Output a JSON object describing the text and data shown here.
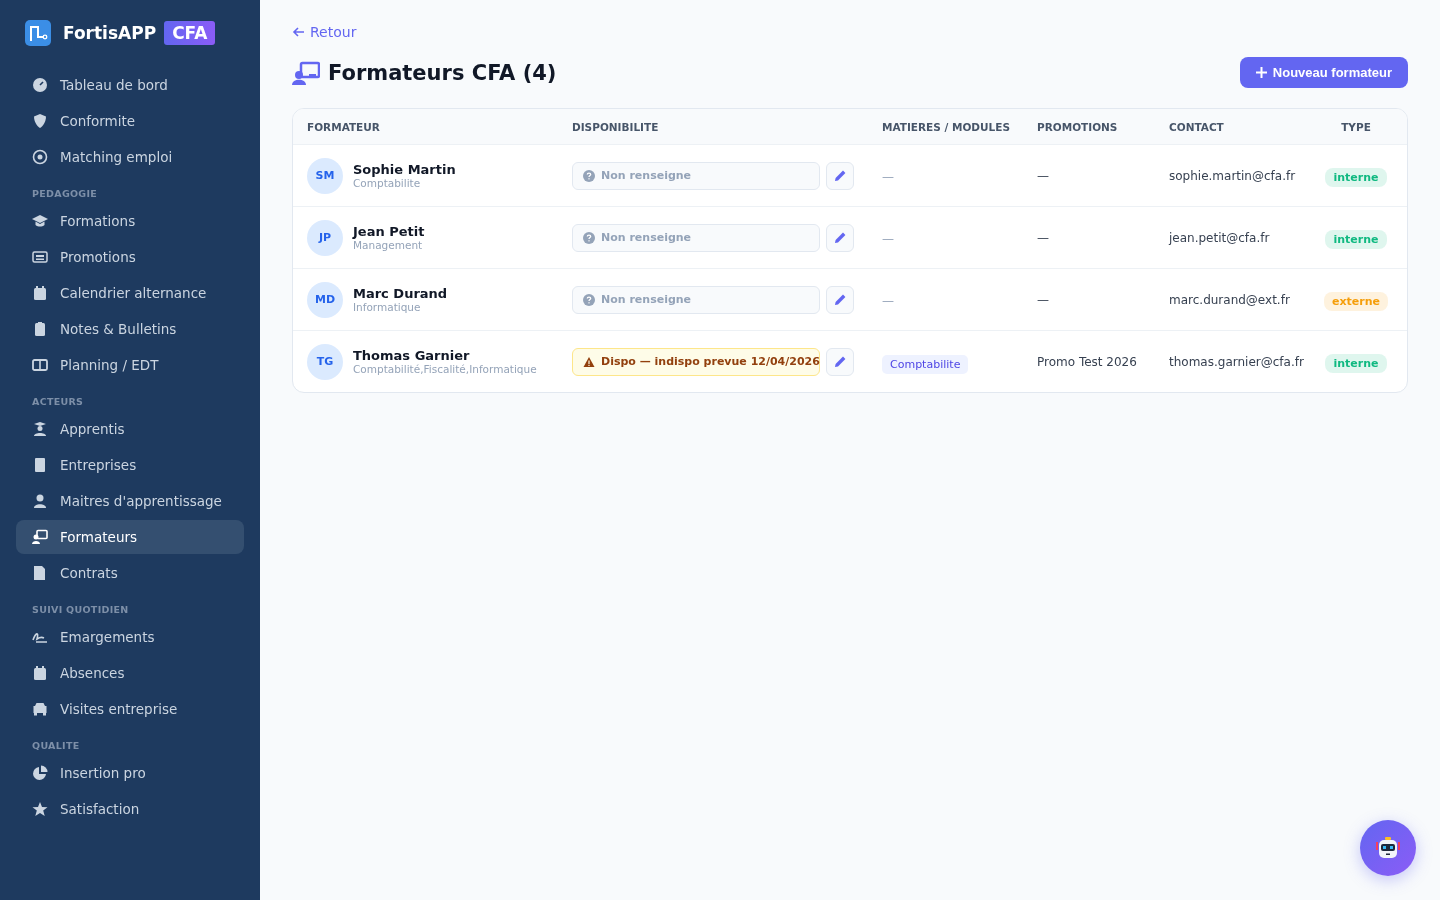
{
  "brand": {
    "name": "FortisAPP",
    "badge": "CFA"
  },
  "sidebar": {
    "sections": [
      {
        "items": [
          {
            "label": "Tableau de bord",
            "selected": false
          },
          {
            "label": "Conformite",
            "selected": false
          },
          {
            "label": "Matching emploi",
            "selected": false
          }
        ]
      },
      {
        "title": "PEDAGOGIE",
        "items": [
          {
            "label": "Formations",
            "selected": false
          },
          {
            "label": "Promotions",
            "selected": false
          },
          {
            "label": "Calendrier alternance",
            "selected": false
          },
          {
            "label": "Notes & Bulletins",
            "selected": false
          },
          {
            "label": "Planning / EDT",
            "selected": false
          }
        ]
      },
      {
        "title": "ACTEURS",
        "items": [
          {
            "label": "Apprentis",
            "selected": false
          },
          {
            "label": "Entreprises",
            "selected": false
          },
          {
            "label": "Maitres d'apprentissage",
            "selected": false
          },
          {
            "label": "Formateurs",
            "selected": true
          },
          {
            "label": "Contrats",
            "selected": false
          }
        ]
      },
      {
        "title": "SUIVI QUOTIDIEN",
        "items": [
          {
            "label": "Emargements",
            "selected": false
          },
          {
            "label": "Absences",
            "selected": false
          },
          {
            "label": "Visites entreprise",
            "selected": false
          }
        ]
      },
      {
        "title": "QUALITE",
        "items": [
          {
            "label": "Insertion pro",
            "selected": false
          },
          {
            "label": "Satisfaction",
            "selected": false
          }
        ]
      }
    ]
  },
  "back_link": "Retour",
  "title": "Formateurs CFA (4)",
  "new_button": "Nouveau formateur",
  "table": {
    "columns": [
      "FORMATEUR",
      "DISPONIBILITE",
      "MATIERES / MODULES",
      "PROMOTIONS",
      "CONTACT",
      "TYPE"
    ],
    "rows": [
      {
        "initials": "SM",
        "name": "Sophie Martin",
        "subtitle": "Comptabilite",
        "availability": {
          "kind": "unset",
          "label": "Non renseigne"
        },
        "modules": [],
        "modules_empty": "—",
        "promotions": "—",
        "contact": "sophie.martin@cfa.fr",
        "type": {
          "label": "interne",
          "color": "#10b981"
        }
      },
      {
        "initials": "JP",
        "name": "Jean Petit",
        "subtitle": "Management",
        "availability": {
          "kind": "unset",
          "label": "Non renseigne"
        },
        "modules": [],
        "modules_empty": "—",
        "promotions": "—",
        "contact": "jean.petit@cfa.fr",
        "type": {
          "label": "interne",
          "color": "#10b981"
        }
      },
      {
        "initials": "MD",
        "name": "Marc Durand",
        "subtitle": "Informatique",
        "availability": {
          "kind": "unset",
          "label": "Non renseigne"
        },
        "modules": [],
        "modules_empty": "—",
        "promotions": "—",
        "contact": "marc.durand@ext.fr",
        "type": {
          "label": "externe",
          "color": "#f59e0b"
        }
      },
      {
        "initials": "TG",
        "name": "Thomas Garnier",
        "subtitle": "Comptabilité,Fiscalité,Informatique",
        "availability": {
          "kind": "warning",
          "label": "Dispo — indispo prevue 12/04/2026"
        },
        "modules": [
          "Comptabilite"
        ],
        "promotions": "Promo Test 2026",
        "contact": "thomas.garnier@cfa.fr",
        "type": {
          "label": "interne",
          "color": "#10b981"
        }
      }
    ]
  }
}
